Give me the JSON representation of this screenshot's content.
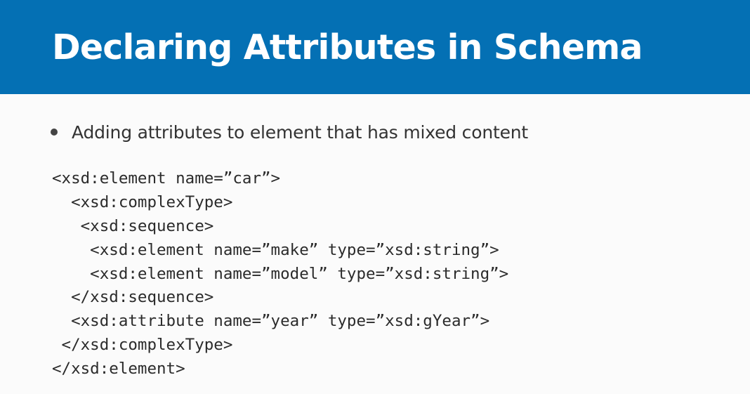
{
  "slide": {
    "title": "Declaring Attributes in Schema",
    "bullet": "Adding attributes to element that has mixed content",
    "code_lines": [
      "<xsd:element name=”car”>",
      "  <xsd:complexType>",
      "   <xsd:sequence>",
      "    <xsd:element name=”make” type=”xsd:string”>",
      "    <xsd:element name=”model” type=”xsd:string”>",
      "  </xsd:sequence>",
      "  <xsd:attribute name=”year” type=”xsd:gYear”>",
      " </xsd:complexType>",
      "</xsd:element>"
    ]
  },
  "colors": {
    "header_background": "#0470b4",
    "header_text": "#ffffff",
    "body_background": "#fbfbfb",
    "body_text": "#333333"
  }
}
